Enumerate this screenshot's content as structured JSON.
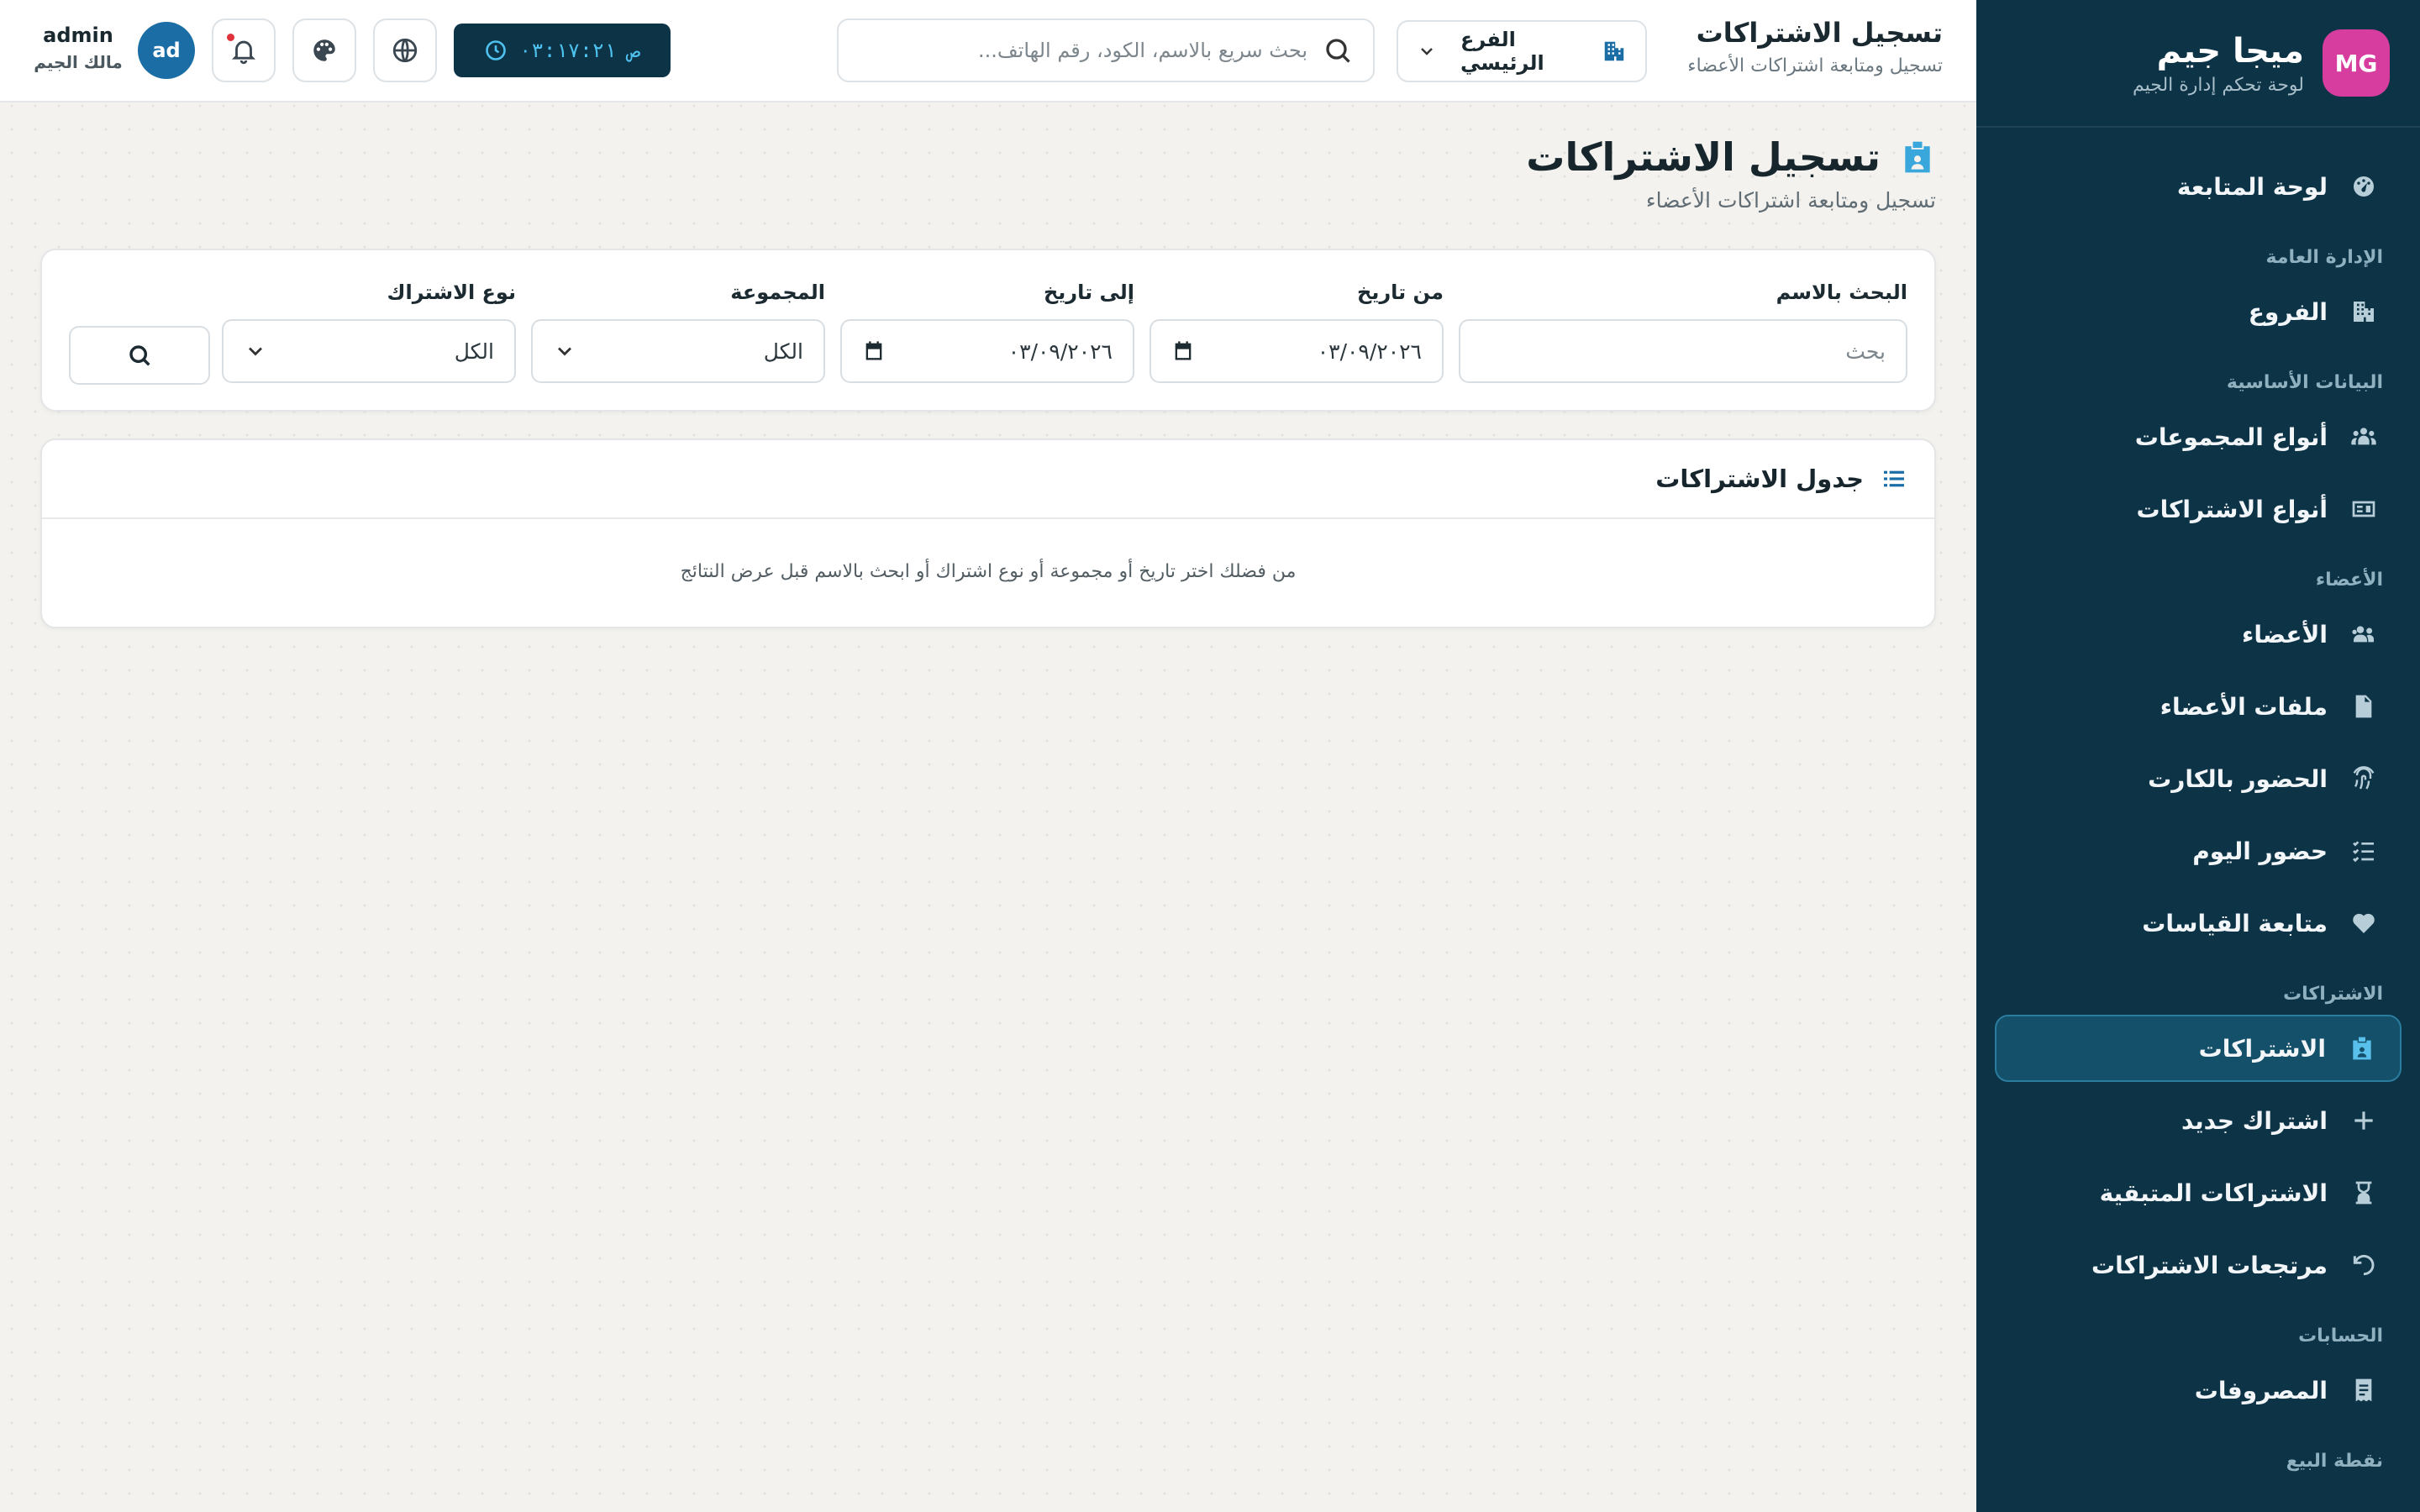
{
  "brand": {
    "logo_text": "MG",
    "name": "ميجا جيم",
    "subtitle": "لوحة تحكم إدارة الجيم"
  },
  "sidebar": {
    "items": [
      {
        "type": "item",
        "label": "لوحة المتابعة",
        "icon": "dashboard-icon"
      },
      {
        "type": "section",
        "label": "الإدارة العامة"
      },
      {
        "type": "item",
        "label": "الفروع",
        "icon": "building-icon"
      },
      {
        "type": "section",
        "label": "البيانات الأساسية"
      },
      {
        "type": "item",
        "label": "أنواع المجموعات",
        "icon": "groups-icon"
      },
      {
        "type": "item",
        "label": "أنواع الاشتراكات",
        "icon": "id-card-icon"
      },
      {
        "type": "section",
        "label": "الأعضاء"
      },
      {
        "type": "item",
        "label": "الأعضاء",
        "icon": "users-icon"
      },
      {
        "type": "item",
        "label": "ملفات الأعضاء",
        "icon": "file-icon"
      },
      {
        "type": "item",
        "label": "الحضور بالكارت",
        "icon": "fingerprint-icon"
      },
      {
        "type": "item",
        "label": "حضور اليوم",
        "icon": "checklist-icon"
      },
      {
        "type": "item",
        "label": "متابعة القياسات",
        "icon": "heart-pulse-icon"
      },
      {
        "type": "section",
        "label": "الاشتراكات"
      },
      {
        "type": "item",
        "label": "الاشتراكات",
        "icon": "badge-icon",
        "active": true
      },
      {
        "type": "item",
        "label": "اشتراك جديد",
        "icon": "plus-icon"
      },
      {
        "type": "item",
        "label": "الاشتراكات المتبقية",
        "icon": "hourglass-icon"
      },
      {
        "type": "item",
        "label": "مرتجعات الاشتراكات",
        "icon": "undo-icon"
      },
      {
        "type": "section",
        "label": "الحسابات"
      },
      {
        "type": "item",
        "label": "المصروفات",
        "icon": "receipt-icon"
      },
      {
        "type": "section",
        "label": "نقطة البيع"
      }
    ]
  },
  "topbar": {
    "title": "تسجيل الاشتراكات",
    "subtitle": "تسجيل ومتابعة اشتراكات الأعضاء",
    "branch": "الفرع الرئيسي",
    "search_placeholder": "بحث سريع بالاسم، الكود، رقم الهاتف...",
    "clock_time": "٠٣:١٧:٢١",
    "clock_period": "ص",
    "avatar_initials": "ad",
    "user_name": "admin",
    "user_role": "مالك الجيم"
  },
  "page": {
    "title": "تسجيل الاشتراكات",
    "subtitle": "تسجيل ومتابعة اشتراكات الأعضاء"
  },
  "filters": {
    "name_label": "البحث بالاسم",
    "name_placeholder": "بحث",
    "from_label": "من تاريخ",
    "from_value": "٠٣/٠٩/٢٠٢٦",
    "to_label": "إلى تاريخ",
    "to_value": "٠٣/٠٩/٢٠٢٦",
    "group_label": "المجموعة",
    "group_value": "الكل",
    "type_label": "نوع الاشتراك",
    "type_value": "الكل"
  },
  "table": {
    "title": "جدول الاشتراكات",
    "empty_message": "من فضلك اختر تاريخ أو مجموعة أو نوع اشتراك أو ابحث بالاسم قبل عرض النتائج"
  },
  "colors": {
    "sidebar_bg": "#0d3347",
    "active_item_bg": "#14506a",
    "accent": "#3aa7dc",
    "logo": "#d63d9e",
    "avatar": "#1b6ea5"
  }
}
